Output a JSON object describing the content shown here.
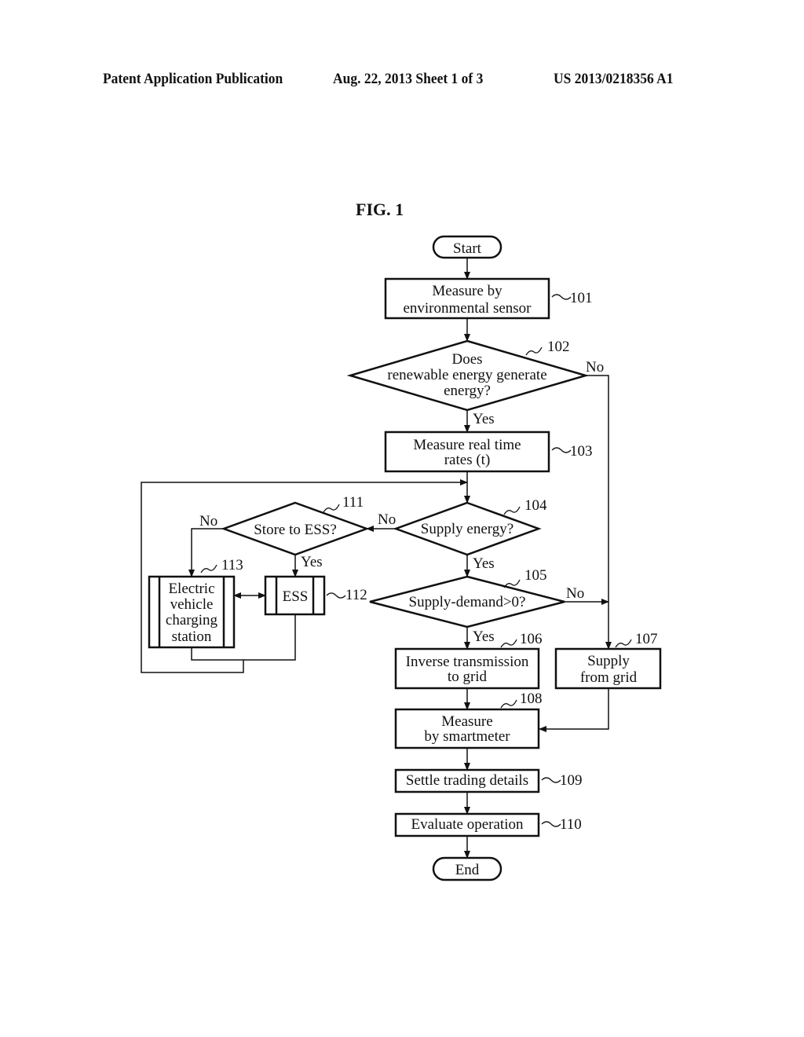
{
  "header": {
    "publication": "Patent Application Publication",
    "date_sheet": "Aug. 22, 2013  Sheet 1 of 3",
    "number": "US 2013/0218356 A1"
  },
  "figure_title": "FIG. 1",
  "nodes": {
    "start": {
      "text": "Start"
    },
    "n101": {
      "ref": "101",
      "lines": [
        "Measure by",
        "environmental sensor"
      ]
    },
    "n102": {
      "ref": "102",
      "lines": [
        "Does",
        "renewable energy generate",
        "energy?"
      ]
    },
    "n103": {
      "ref": "103",
      "lines": [
        "Measure real time",
        "rates (t)"
      ]
    },
    "n104": {
      "ref": "104",
      "lines": [
        "Supply energy?"
      ]
    },
    "n105": {
      "ref": "105",
      "lines": [
        "Supply-demand>0?"
      ]
    },
    "n106": {
      "ref": "106",
      "lines": [
        "Inverse transmission",
        "to grid"
      ]
    },
    "n107": {
      "ref": "107",
      "lines": [
        "Supply",
        "from grid"
      ]
    },
    "n108": {
      "ref": "108",
      "lines": [
        "Measure",
        "by smartmeter"
      ]
    },
    "n109": {
      "ref": "109",
      "lines": [
        "Settle trading details"
      ]
    },
    "n110": {
      "ref": "110",
      "lines": [
        "Evaluate operation"
      ]
    },
    "n111": {
      "ref": "111",
      "lines": [
        "Store to ESS?"
      ]
    },
    "n112": {
      "ref": "112",
      "lines": [
        "ESS"
      ]
    },
    "n113": {
      "ref": "113",
      "lines": [
        "Electric",
        "vehicle",
        "charging",
        "station"
      ]
    },
    "end": {
      "text": "End"
    }
  },
  "edge_labels": {
    "n102_no": "No",
    "n102_yes": "Yes",
    "n104_no": "No",
    "n104_yes": "Yes",
    "n105_no": "No",
    "n105_yes": "Yes",
    "n111_no": "No",
    "n111_yes": "Yes"
  }
}
